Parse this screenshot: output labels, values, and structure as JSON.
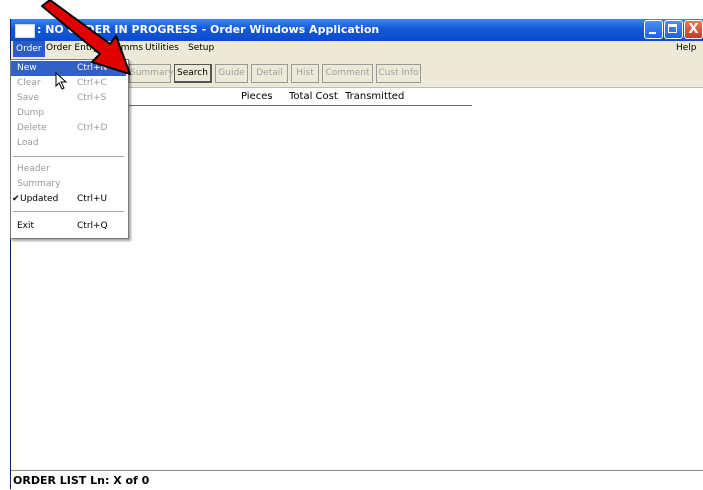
{
  "window": {
    "title": ": NO ORDER IN PROGRESS - Order Windows Application",
    "minimize_glyph": "",
    "close_glyph": "X"
  },
  "menubar": {
    "items": [
      "Order",
      "Order Entry",
      "Comms",
      "Utilities",
      "Setup"
    ],
    "help": "Help"
  },
  "toolbar": {
    "buttons": [
      "Summary",
      "Search",
      "Guide",
      "Detail",
      "Hist",
      "Comment",
      "Cust Info"
    ],
    "enabled": "Search"
  },
  "list": {
    "columns": [
      "Pieces",
      "Total Cost",
      "Transmitted"
    ]
  },
  "order_menu": {
    "items": [
      {
        "label": "New",
        "shortcut": "Ctrl+N",
        "state": "highlighted"
      },
      {
        "label": "Clear",
        "shortcut": "Ctrl+C",
        "state": "disabled"
      },
      {
        "label": "Save",
        "shortcut": "Ctrl+S",
        "state": "disabled"
      },
      {
        "label": "Dump",
        "shortcut": "",
        "state": "disabled"
      },
      {
        "label": "Delete",
        "shortcut": "Ctrl+D",
        "state": "disabled"
      },
      {
        "label": "Load",
        "shortcut": "",
        "state": "disabled"
      },
      {
        "label": "Header",
        "shortcut": "",
        "state": "disabled"
      },
      {
        "label": "Summary",
        "shortcut": "",
        "state": "disabled"
      },
      {
        "label": "Updated",
        "shortcut": "Ctrl+U",
        "state": "checked"
      },
      {
        "label": "Exit",
        "shortcut": "Ctrl+Q",
        "state": "normal"
      }
    ],
    "check_glyph": "✔"
  },
  "status": {
    "text": "ORDER LIST   Ln: X of 0"
  },
  "colors": {
    "title_bar": "#1458d6",
    "menu_highlight": "#3161c5",
    "annotation_arrow": "#e00000"
  }
}
